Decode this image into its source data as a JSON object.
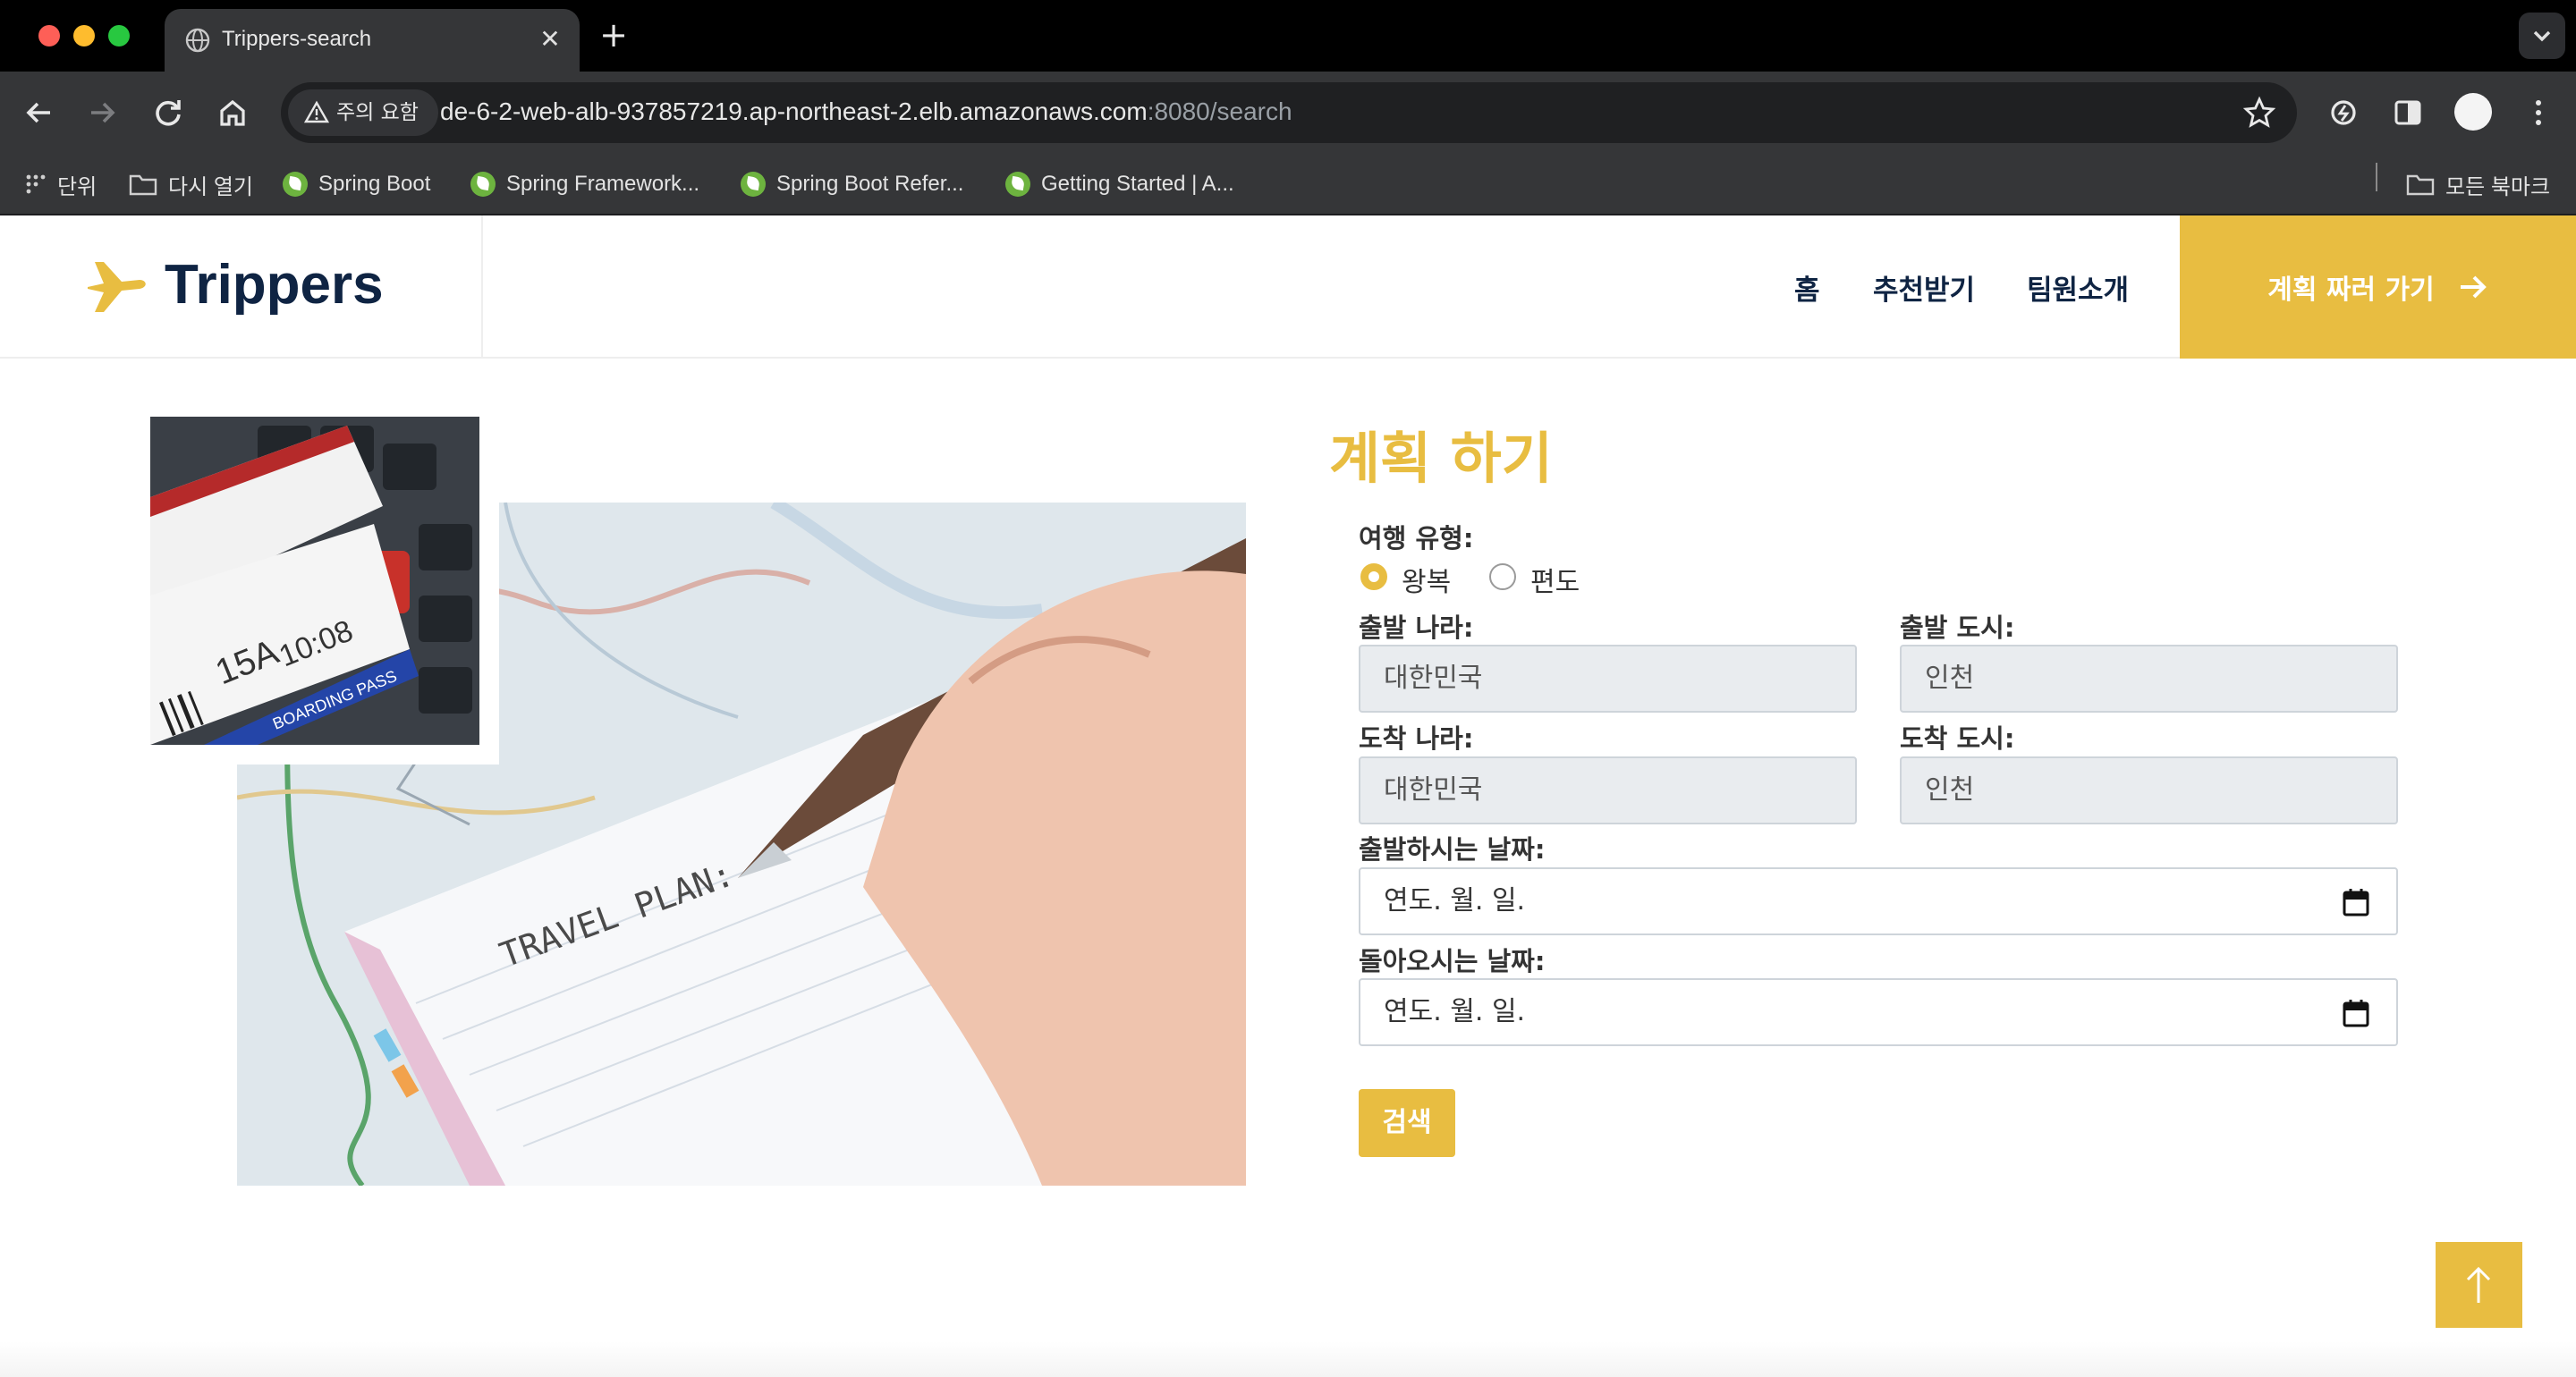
{
  "browser": {
    "tab_title": "Trippers-search",
    "new_tab_symbol": "+",
    "close_symbol": "✕",
    "security_chip": "주의 요함",
    "url_main": "de-6-2-web-alb-937857219.ap-northeast-2.elb.amazonaws.com",
    "url_rest": ":8080/search",
    "bookmarks": [
      {
        "label": "단위",
        "icon": "apps-grid-icon"
      },
      {
        "label": "다시 열기",
        "icon": "folder-icon"
      },
      {
        "label": "Spring Boot",
        "icon": "spring-leaf-icon"
      },
      {
        "label": "Spring Framework...",
        "icon": "spring-leaf-icon"
      },
      {
        "label": "Spring Boot Refer...",
        "icon": "spring-leaf-icon"
      },
      {
        "label": "Getting Started | A...",
        "icon": "spring-leaf-icon"
      }
    ],
    "all_bookmarks": "모든 북마크"
  },
  "header": {
    "brand": "Trippers",
    "nav": [
      "홈",
      "추천받기",
      "팀원소개"
    ],
    "cta_label": "계획 짜러 가기"
  },
  "form": {
    "title": "계획 하기",
    "trip_type_label": "여행 유형:",
    "trip_types": [
      {
        "label": "왕복",
        "selected": true
      },
      {
        "label": "편도",
        "selected": false
      }
    ],
    "departure_country_label": "출발 나라:",
    "departure_country_value": "대한민국",
    "departure_city_label": "출발 도시:",
    "departure_city_value": "인천",
    "arrival_country_label": "도착 나라:",
    "arrival_country_value": "대한민국",
    "arrival_city_label": "도착 도시:",
    "arrival_city_value": "인천",
    "departure_date_label": "출발하시는 날짜:",
    "departure_date_placeholder": "연도. 월. 일.",
    "return_date_label": "돌아오시는 날짜:",
    "return_date_placeholder": "연도. 월. 일.",
    "submit_label": "검색"
  },
  "images": {
    "tickets_text": [
      "BOARDING PASS",
      "15A",
      "10:08"
    ],
    "map_note_text": "TRAVEL PLAN:"
  },
  "colors": {
    "accent": "#e8bd41",
    "brand_navy": "#0f2443",
    "field_bg": "#e9ecef"
  }
}
